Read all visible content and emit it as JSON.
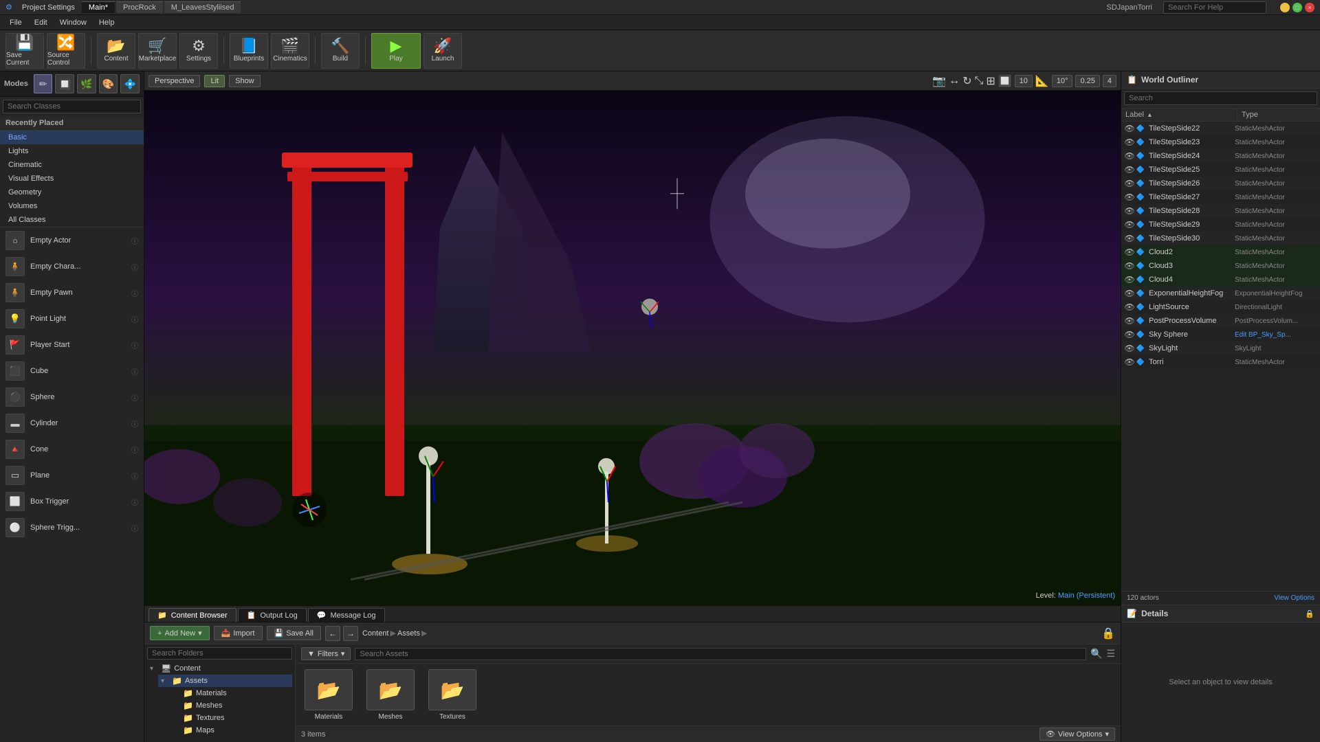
{
  "titlebar": {
    "project_icon": "⚙",
    "project_title": "Project Settings",
    "tabs": [
      {
        "label": "Main*",
        "active": true
      },
      {
        "label": "ProcRock",
        "active": false
      },
      {
        "label": "M_LeavesStyliised",
        "active": false
      }
    ],
    "window_title": "SDJapanTorri",
    "search_placeholder": "Search For Help",
    "minimize": "−",
    "maximize": "□",
    "close": "×"
  },
  "menubar": {
    "items": [
      "File",
      "Edit",
      "Window",
      "Help"
    ]
  },
  "toolbar": {
    "save_current_label": "Save Current",
    "source_control_label": "Source Control",
    "content_label": "Content",
    "marketplace_label": "Marketplace",
    "settings_label": "Settings",
    "blueprints_label": "Blueprints",
    "cinematics_label": "Cinematics",
    "build_label": "Build",
    "play_label": "Play",
    "launch_label": "Launch"
  },
  "modes": {
    "label": "Modes",
    "icons": [
      "✏",
      "🔲",
      "🎨",
      "💧",
      "🌿"
    ]
  },
  "left_panel": {
    "search_placeholder": "Search Classes",
    "recently_placed": "Recently Placed",
    "categories": [
      {
        "label": "Basic",
        "active": true
      },
      {
        "label": "Lights",
        "active": false
      },
      {
        "label": "Cinematic",
        "active": false
      },
      {
        "label": "Visual Effects",
        "active": false
      },
      {
        "label": "Geometry",
        "active": false
      },
      {
        "label": "Volumes",
        "active": false
      },
      {
        "label": "All Classes",
        "active": false
      }
    ],
    "objects": [
      {
        "label": "Empty Actor",
        "icon": "○"
      },
      {
        "label": "Empty Chara...",
        "icon": "🧍"
      },
      {
        "label": "Empty Pawn",
        "icon": "🧍"
      },
      {
        "label": "Point Light",
        "icon": "💡"
      },
      {
        "label": "Player Start",
        "icon": "🚩"
      },
      {
        "label": "Cube",
        "icon": "⬛"
      },
      {
        "label": "Sphere",
        "icon": "⚫"
      },
      {
        "label": "Cylinder",
        "icon": "🔵"
      },
      {
        "label": "Cone",
        "icon": "🔺"
      },
      {
        "label": "Plane",
        "icon": "▬"
      },
      {
        "label": "Box Trigger",
        "icon": "⬜"
      },
      {
        "label": "Sphere Trigg...",
        "icon": "⚪"
      }
    ]
  },
  "viewport": {
    "perspective_label": "Perspective",
    "lit_label": "Lit",
    "show_label": "Show",
    "grid_value": "10",
    "angle_value": "10°",
    "scale_value": "0.25",
    "level_label": "Level:",
    "level_value": "Main (Persistent)"
  },
  "world_outliner": {
    "title": "World Outliner",
    "search_placeholder": "Search",
    "columns": {
      "label": "Label",
      "type": "Type"
    },
    "actors_count": "120 actors",
    "view_options": "View Options",
    "rows": [
      {
        "label": "TileStepSide22",
        "type": "StaticMeshActor"
      },
      {
        "label": "TileStepSide23",
        "type": "StaticMeshActor"
      },
      {
        "label": "TileStepSide24",
        "type": "StaticMeshActor"
      },
      {
        "label": "TileStepSide25",
        "type": "StaticMeshActor"
      },
      {
        "label": "TileStepSide26",
        "type": "StaticMeshActor"
      },
      {
        "label": "TileStepSide27",
        "type": "StaticMeshActor"
      },
      {
        "label": "TileStepSide28",
        "type": "StaticMeshActor"
      },
      {
        "label": "TileStepSide29",
        "type": "StaticMeshActor"
      },
      {
        "label": "TileStepSide30",
        "type": "StaticMeshActor"
      },
      {
        "label": "Cloud2",
        "type": "StaticMeshActor",
        "highlighted": true
      },
      {
        "label": "Cloud3",
        "type": "StaticMeshActor",
        "highlighted": true
      },
      {
        "label": "Cloud4",
        "type": "StaticMeshActor",
        "highlighted": true
      },
      {
        "label": "ExponentialHeightFog",
        "type": "ExponentialHeightFog"
      },
      {
        "label": "LightSource",
        "type": "DirectionalLight"
      },
      {
        "label": "PostProcessVolume",
        "type": "PostProcessVolum..."
      },
      {
        "label": "Sky Sphere",
        "type": "Edit BP_Sky_Sp...",
        "is_link": true
      },
      {
        "label": "SkyLight",
        "type": "SkyLight"
      },
      {
        "label": "Torri",
        "type": "StaticMeshActor"
      }
    ]
  },
  "details_panel": {
    "title": "Details",
    "empty_message": "Select an object to view details"
  },
  "bottom_tabs": [
    {
      "label": "Content Browser",
      "active": true,
      "icon": "📁"
    },
    {
      "label": "Output Log",
      "active": false,
      "icon": "📋"
    },
    {
      "label": "Message Log",
      "active": false,
      "icon": "💬"
    }
  ],
  "content_browser": {
    "add_new_label": "Add New",
    "import_label": "Import",
    "save_all_label": "Save All",
    "filters_label": "Filters",
    "search_placeholder": "Search Assets",
    "path": [
      "Content",
      "Assets"
    ],
    "tree": {
      "items": [
        {
          "label": "Content",
          "expanded": true,
          "level": 0,
          "children": [
            {
              "label": "Assets",
              "expanded": true,
              "level": 1,
              "children": [
                {
                  "label": "Materials",
                  "level": 2
                },
                {
                  "label": "Meshes",
                  "level": 2
                },
                {
                  "label": "Textures",
                  "level": 2
                },
                {
                  "label": "Maps",
                  "level": 2
                }
              ]
            }
          ]
        }
      ]
    },
    "assets": [
      {
        "label": "Materials",
        "icon": "📦"
      },
      {
        "label": "Meshes",
        "icon": "📦"
      },
      {
        "label": "Textures",
        "icon": "📦"
      }
    ],
    "items_count": "3 items",
    "view_options_label": "View Options"
  }
}
